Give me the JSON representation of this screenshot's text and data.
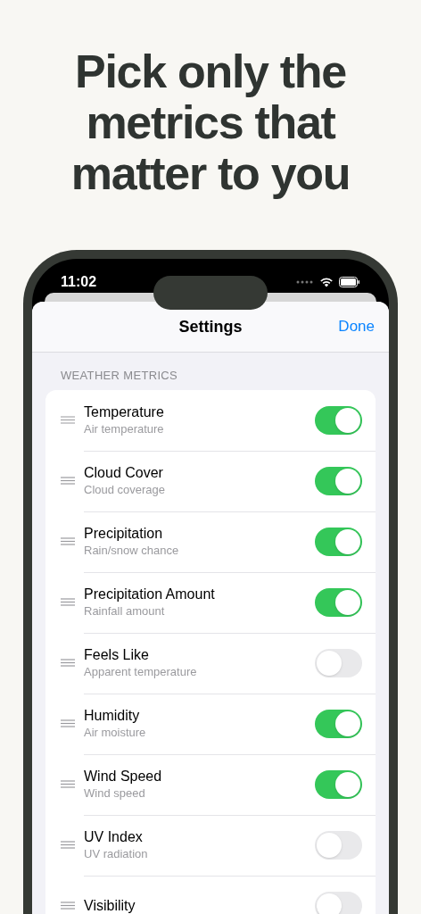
{
  "headline": "Pick only the metrics that matter to you",
  "status_bar": {
    "time": "11:02"
  },
  "nav": {
    "title": "Settings",
    "done": "Done"
  },
  "section": {
    "title": "WEATHER METRICS"
  },
  "metrics": [
    {
      "name": "Temperature",
      "detail": "Air temperature",
      "on": true
    },
    {
      "name": "Cloud Cover",
      "detail": "Cloud coverage",
      "on": true
    },
    {
      "name": "Precipitation",
      "detail": "Rain/snow chance",
      "on": true
    },
    {
      "name": "Precipitation Amount",
      "detail": "Rainfall amount",
      "on": true
    },
    {
      "name": "Feels Like",
      "detail": "Apparent temperature",
      "on": false
    },
    {
      "name": "Humidity",
      "detail": "Air moisture",
      "on": true
    },
    {
      "name": "Wind Speed",
      "detail": "Wind speed",
      "on": true
    },
    {
      "name": "UV Index",
      "detail": "UV radiation",
      "on": false
    },
    {
      "name": "Visibility",
      "on": false
    }
  ]
}
